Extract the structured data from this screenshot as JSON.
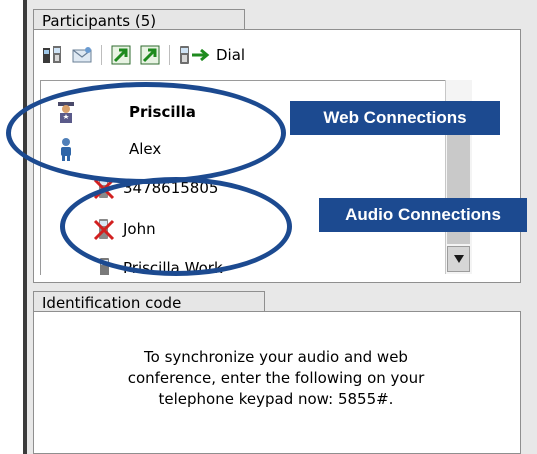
{
  "participants": {
    "tab_label": "Participants (5)",
    "toolbar": {
      "dial_label": "Dial",
      "icons": [
        "phone-transfer-icon",
        "envelope-icon",
        "green-arrow-icon",
        "green-arrow-alt-icon",
        "phone-dial-icon"
      ]
    },
    "items": [
      {
        "name": "Priscilla",
        "icon": "moderator-person-icon",
        "bold": true
      },
      {
        "name": "Alex",
        "icon": "person-icon",
        "bold": false
      },
      {
        "name": "3478615805",
        "icon": "phone-muted-icon",
        "bold": false
      },
      {
        "name": "John",
        "icon": "phone-muted-icon",
        "bold": false
      },
      {
        "name": "Priscilla Work",
        "icon": "phone-icon",
        "bold": false
      }
    ]
  },
  "identification": {
    "tab_label": "Identification code",
    "message_lines": [
      "To synchronize your audio and web",
      "conference, enter the following on your",
      "telephone keypad now: 5855#."
    ]
  },
  "callouts": {
    "web": "Web Connections",
    "audio": "Audio Connections"
  },
  "colors": {
    "callout": "#1c4a90",
    "panel": "#e8e8e8"
  }
}
